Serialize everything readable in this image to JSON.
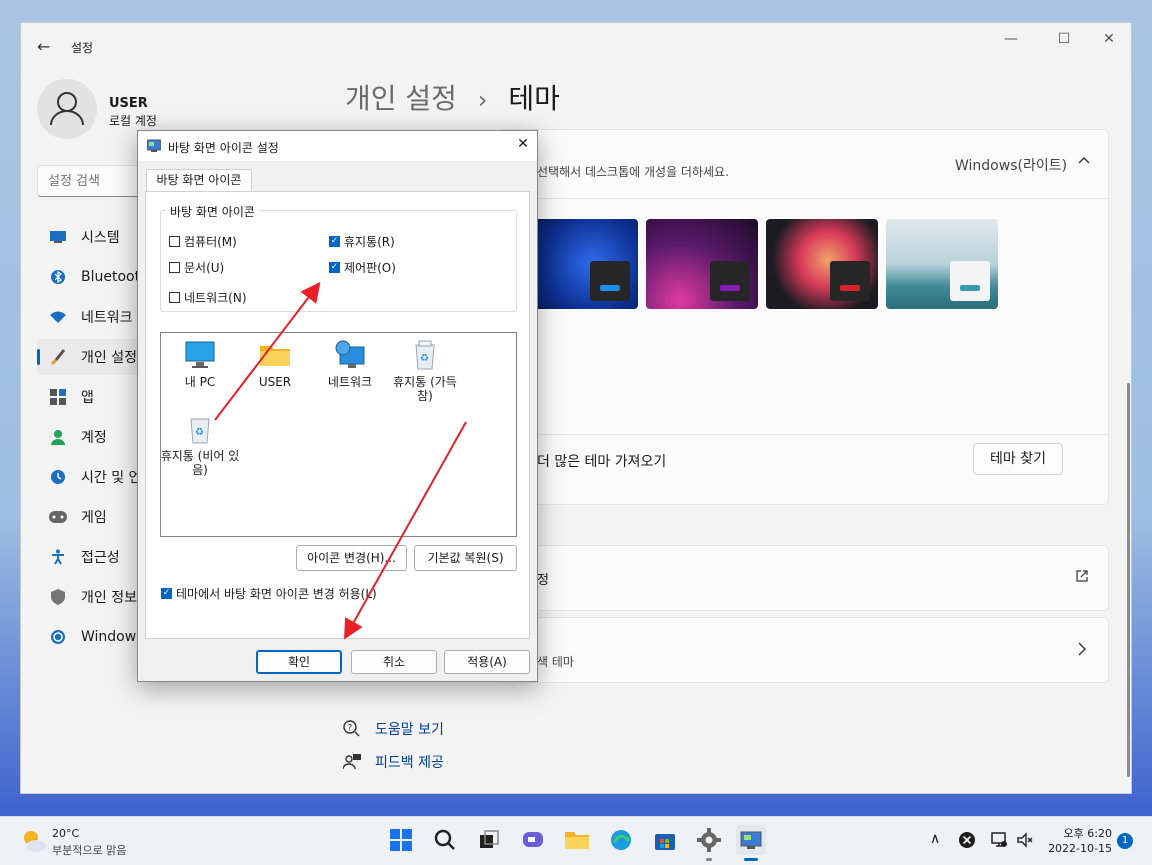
{
  "settings": {
    "back_label": "←",
    "app_title": "설정",
    "user_name": "USER",
    "user_type": "로컬 계정",
    "search_placeholder": "설정 검색",
    "breadcrumb_parent": "개인 설정",
    "breadcrumb_sep": "›",
    "breadcrumb_current": "테마",
    "sidebar": [
      {
        "label": "시스템",
        "icon": "monitor-icon"
      },
      {
        "label": "Bluetooth",
        "icon": "bluetooth-icon"
      },
      {
        "label": "네트워크",
        "icon": "wifi-icon"
      },
      {
        "label": "개인 설정",
        "icon": "brush-icon",
        "selected": true
      },
      {
        "label": "앱",
        "icon": "apps-icon"
      },
      {
        "label": "계정",
        "icon": "person-icon"
      },
      {
        "label": "시간 및 언",
        "icon": "clock-globe-icon"
      },
      {
        "label": "게임",
        "icon": "gamepad-icon"
      },
      {
        "label": "접근성",
        "icon": "accessibility-icon"
      },
      {
        "label": "개인 정보",
        "icon": "shield-icon"
      },
      {
        "label": "Windows",
        "icon": "update-icon"
      }
    ],
    "theme_card_desc": "선택해서 데스크톱에 개성을 더하세요.",
    "current_theme": "Windows(라이트)",
    "more_themes_label": "더 많은 테마 가져오기",
    "find_themes_button": "테마 찾기",
    "card3_text": "정",
    "card4_text": "색 테마",
    "help_link": "도움말 보기",
    "feedback_link": "피드백 제공",
    "accent_color": "#0067c0"
  },
  "dialog": {
    "title": "바탕 화면 아이콘 설정",
    "tab_label": "바탕 화면 아이콘",
    "group_label": "바탕 화면 아이콘",
    "checkboxes": [
      {
        "label": "컴퓨터(M)",
        "checked": false
      },
      {
        "label": "휴지통(R)",
        "checked": true
      },
      {
        "label": "문서(U)",
        "checked": false
      },
      {
        "label": "제어판(O)",
        "checked": true
      },
      {
        "label": "네트워크(N)",
        "checked": false
      }
    ],
    "icons": [
      {
        "label": "내 PC"
      },
      {
        "label": "USER"
      },
      {
        "label": "네트워크"
      },
      {
        "label": "휴지통 (가득 참)"
      },
      {
        "label": "휴지통 (비어 있음)"
      }
    ],
    "change_icon_button": "아이콘 변경(H)...",
    "restore_default_button": "기본값 복원(S)",
    "allow_theme_label": "테마에서 바탕 화면 아이콘 변경 허용(L)",
    "allow_theme_checked": true,
    "ok_button": "확인",
    "cancel_button": "취소",
    "apply_button": "적용(A)"
  },
  "taskbar": {
    "weather_temp": "20°C",
    "weather_desc": "부분적으로 맑음",
    "clock_time": "오후 6:20",
    "clock_date": "2022-10-15",
    "notification_count": "1",
    "tray_chevron": "∧"
  }
}
